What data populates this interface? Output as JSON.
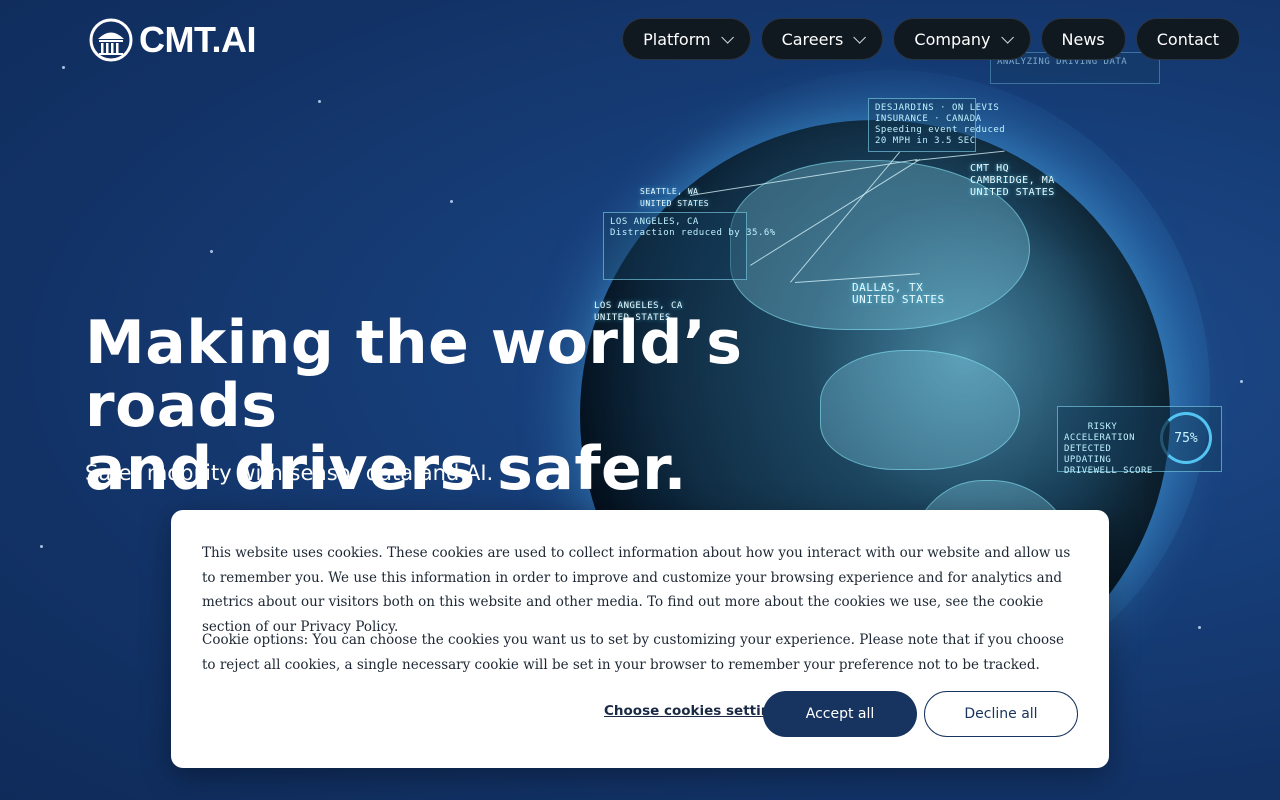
{
  "header": {
    "logo_text": "CMT.AI",
    "nav": [
      {
        "label": "Platform",
        "has_dropdown": true
      },
      {
        "label": "Careers",
        "has_dropdown": true
      },
      {
        "label": "Company",
        "has_dropdown": true
      },
      {
        "label": "News",
        "has_dropdown": false
      },
      {
        "label": "Contact",
        "has_dropdown": false
      }
    ]
  },
  "hero": {
    "title_line1": "Making the world’s roads",
    "title_line2": "and drivers safer.",
    "subtitle": "Safer mobility with sensor data and AI."
  },
  "globe_overlays": {
    "hud_top": "DESJARDINS · ON LEVIS\nINSURANCE · CANADA\nSpeeding event reduced\n20 MPH in 3.5 SEC",
    "hud_top_right": "ANALYZING DRIVING DATA",
    "hud_left": "LOS ANGELES, CA\nDistraction reduced by 35.6%",
    "seattle": "SEATTLE, WA\nUNITED STATES",
    "los_angeles": "LOS ANGELES, CA\nUNITED STATES",
    "cambridge": "CMT HQ\nCAMBRIDGE, MA\nUNITED STATES",
    "dallas": "DALLAS, TX\nUNITED STATES",
    "hud_right": "RISKY\nACCELERATION\nDETECTED\nUPDATING\nDRIVEWELL SCORE",
    "hud_right_percent": "75%"
  },
  "cookie_banner": {
    "paragraph1": "This website uses cookies. These cookies are used to collect information about how you interact with our website and allow us to remember you. We use this information in order to improve and customize your browsing experience and for analytics and metrics about our visitors both on this website and other media. To find out more about the cookies we use, see the cookie section of our Privacy Policy.",
    "paragraph2": "Cookie options: You can choose the cookies you want us to set by customizing your experience. Please note that if you choose to reject all cookies, a single necessary cookie will be set in your browser to remember your preference not to be tracked.",
    "settings_link": "Choose cookies settings",
    "accept_label": "Accept all",
    "decline_label": "Decline all"
  },
  "colors": {
    "background": "#173f7a",
    "nav_pill": "#101820",
    "accept_button": "#16345f",
    "banner": "#ffffff"
  },
  "icons": {
    "logo": "capitol-dome-logo-icon",
    "dropdown": "chevron-down-icon"
  }
}
